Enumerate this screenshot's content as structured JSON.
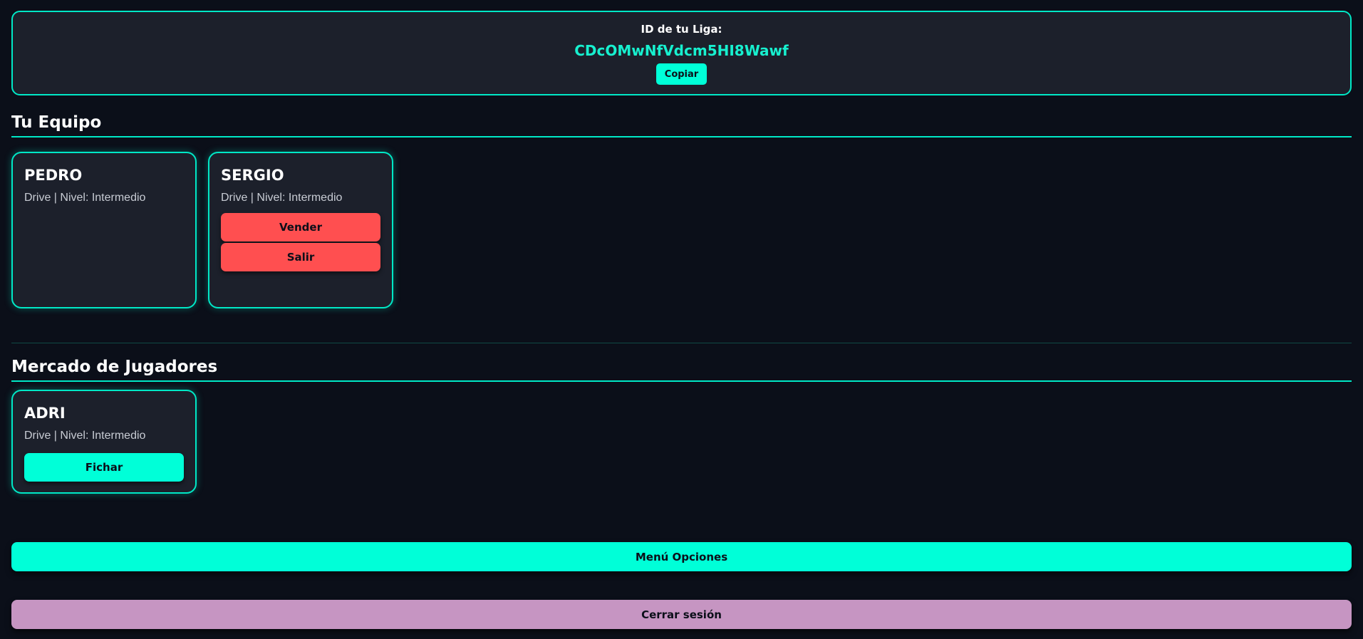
{
  "league": {
    "label": "ID de tu Liga:",
    "id": "CDcOMwNfVdcm5HI8Wawf",
    "copy_label": "Copiar"
  },
  "team": {
    "title": "Tu Equipo",
    "players": [
      {
        "name": "PEDRO",
        "info": "Drive | Nivel: Intermedio"
      },
      {
        "name": "SERGIO",
        "info": "Drive | Nivel: Intermedio",
        "sell_label": "Vender",
        "leave_label": "Salir"
      }
    ]
  },
  "market": {
    "title": "Mercado de Jugadores",
    "players": [
      {
        "name": "ADRI",
        "info": "Drive | Nivel: Intermedio",
        "sign_label": "Fichar"
      }
    ]
  },
  "actions": {
    "menu_label": "Menú Opciones",
    "logout_label": "Cerrar sesión"
  },
  "colors": {
    "background": "#0b0f19",
    "card": "#1c202b",
    "accent": "#00ffd8",
    "danger": "#ff4f50",
    "logout": "#c695c2"
  }
}
